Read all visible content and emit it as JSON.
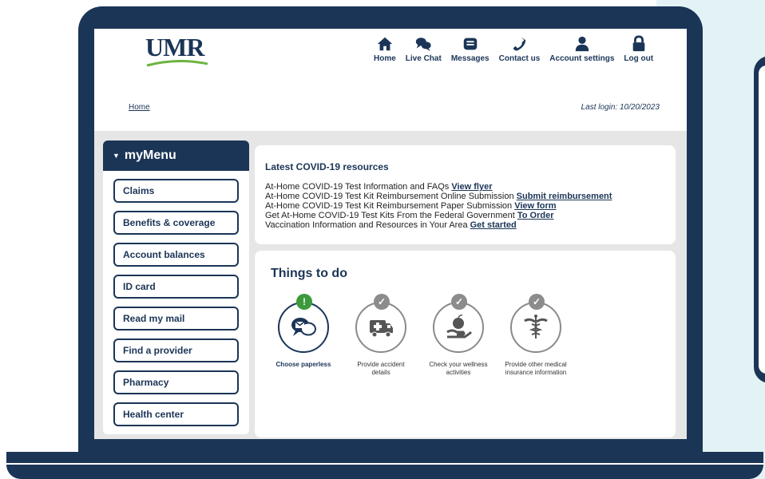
{
  "header": {
    "logo_text": "UMR",
    "nav": [
      {
        "label": "Home",
        "icon": "home-icon"
      },
      {
        "label": "Live Chat",
        "icon": "chat-icon"
      },
      {
        "label": "Messages",
        "icon": "messages-icon"
      },
      {
        "label": "Contact us",
        "icon": "phone-icon"
      },
      {
        "label": "Account settings",
        "icon": "user-icon"
      },
      {
        "label": "Log out",
        "icon": "lock-icon"
      }
    ]
  },
  "breadcrumb": {
    "home": "Home"
  },
  "last_login": "Last login: 10/20/2023",
  "mymenu": {
    "title": "myMenu",
    "items": [
      "Claims",
      "Benefits & coverage",
      "Account balances",
      "ID card",
      "Read my mail",
      "Find a provider",
      "Pharmacy",
      "Health center"
    ]
  },
  "covid": {
    "title": "Latest COVID-19 resources",
    "lines": [
      {
        "text": "At-Home COVID-19 Test Information and FAQs ",
        "link": "View flyer"
      },
      {
        "text": "At-Home COVID-19 Test Kit Reimbursement Online Submission ",
        "link": "Submit reimbursement"
      },
      {
        "text": "At-Home COVID-19 Test Kit Reimbursement Paper Submission ",
        "link": "View form"
      },
      {
        "text": "Get At-Home COVID-19 Test Kits From the Federal Government ",
        "link": "To Order"
      },
      {
        "text": "Vaccination Information and Resources in Your Area ",
        "link": "Get started"
      }
    ]
  },
  "todo": {
    "title": "Things to do",
    "items": [
      {
        "label": "Choose paperless",
        "icon": "paperless-icon",
        "badge": "!",
        "status": "alert"
      },
      {
        "label": "Provide accident details",
        "icon": "ambulance-icon",
        "badge": "✓",
        "status": "done"
      },
      {
        "label": "Check your wellness activities",
        "icon": "apple-hand-icon",
        "badge": "✓",
        "status": "done"
      },
      {
        "label": "Provide other medical insurance information",
        "icon": "caduceus-icon",
        "badge": "✓",
        "status": "done"
      }
    ]
  },
  "colors": {
    "navy": "#1b3557",
    "green": "#3c9a3c",
    "bg_panel": "#e3f3f5"
  }
}
